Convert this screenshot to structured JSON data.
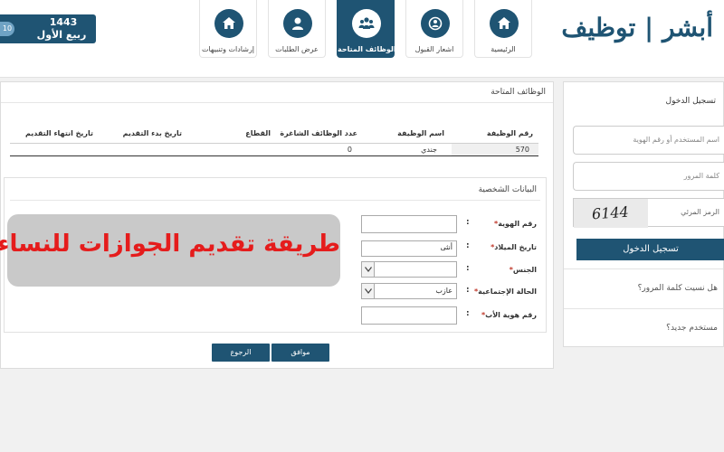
{
  "header": {
    "date_year": "1443",
    "date_month": "ربيع الأول",
    "date_day": "10",
    "logo_text": "أبشر | توظيف",
    "nav": [
      {
        "label": "الرئيسية",
        "icon": "home-icon"
      },
      {
        "label": "اشعار القبول",
        "icon": "notice-icon"
      },
      {
        "label": "الوظائف المتاحة",
        "icon": "group-icon"
      },
      {
        "label": "عرض الطلبات",
        "icon": "user-icon"
      },
      {
        "label": "إرشادات وتنبيهات",
        "icon": "home-icon"
      }
    ]
  },
  "jobs": {
    "title": "الوظائف المتاحة",
    "columns": [
      "رقم الوظيفة",
      "اسم الوظيفة",
      "عدد الوظائف الشاغرة",
      "القطاع",
      "تاريخ بدء التقديم",
      "تاريخ انتهاء التقديم"
    ],
    "rows": [
      {
        "number": "570",
        "name": "جندي",
        "vacancies": "0",
        "sector": "",
        "start": "",
        "end": ""
      }
    ]
  },
  "personal": {
    "title": "البيانات الشخصية",
    "fields": {
      "id_label": "رقم الهوية",
      "birth_label": "تاريخ الميلاد",
      "birth_value": "أنثى",
      "gender_label": "الجنس",
      "gender_value": "",
      "marital_label": "الحالة الإجتماعية",
      "marital_value": "عازب",
      "father_id_label": "رقم هوية الأب"
    },
    "required_mark": "*",
    "colon": ":"
  },
  "overlay": {
    "text": "طريقة تقديم الجوازات للنساء"
  },
  "buttons": {
    "ok": "موافق",
    "back": "الرجوع"
  },
  "login": {
    "title": "تسجيل الدخول",
    "username_placeholder": "اسم المستخدم أو رقم الهوية",
    "password_placeholder": "كلمة المرور",
    "captcha_value": "6144",
    "captcha_label": "الرمز المرئي",
    "submit": "تسجيل الدخول",
    "forgot": "هل نسيت كلمة المرور؟",
    "new_user": "مستخدم جديد؟"
  },
  "colors": {
    "primary": "#1f5473",
    "overlay_text": "#e51c1c",
    "overlay_bg": "#c9c9c9"
  }
}
